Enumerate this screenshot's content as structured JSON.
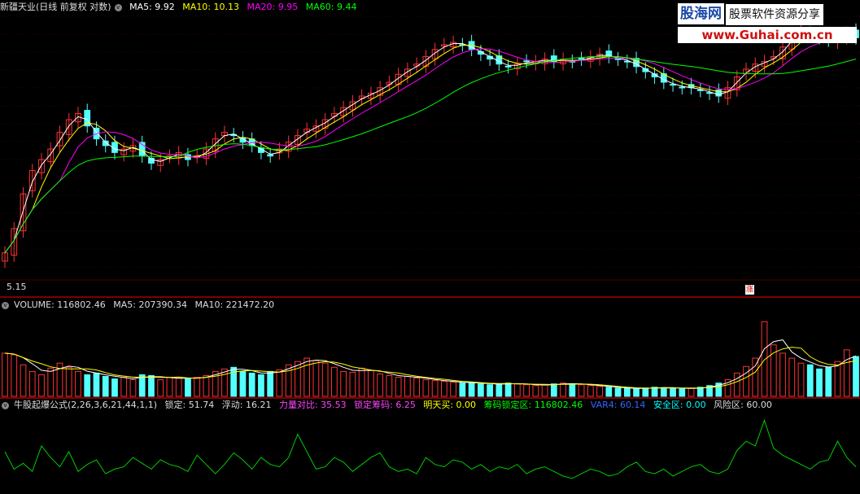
{
  "price_header": {
    "title": "新疆天业(日线 前复权 对数)",
    "indicators": [
      {
        "label": "MA5: 9.92",
        "color": "#ffffff"
      },
      {
        "label": "MA10: 10.13",
        "color": "#ffff00"
      },
      {
        "label": "MA20: 9.95",
        "color": "#ff00ff"
      },
      {
        "label": "MA60: 9.44",
        "color": "#00ff00"
      }
    ]
  },
  "volume_header": {
    "indicators": [
      {
        "label": "VOLUME: 116802.46",
        "color": "#dddddd"
      },
      {
        "label": "MA5: 207390.34",
        "color": "#dddddd"
      },
      {
        "label": "MA10: 221472.20",
        "color": "#dddddd"
      }
    ]
  },
  "formula_header": {
    "indicators": [
      {
        "label": "牛股起爆公式(2,26,3,6,21,44,1,1)",
        "color": "#dddddd"
      },
      {
        "label": "锁定: 51.74",
        "color": "#dddddd"
      },
      {
        "label": "浮动: 16.21",
        "color": "#dddddd"
      },
      {
        "label": "力量对比: 35.53",
        "color": "#ff44ff"
      },
      {
        "label": "锁定筹码: 6.25",
        "color": "#ff44ff"
      },
      {
        "label": "明天买: 0.00",
        "color": "#ffff00"
      },
      {
        "label": "筹码锁定区: 116802.46",
        "color": "#00ff00"
      },
      {
        "label": "VAR4: 60.14",
        "color": "#3366ff"
      },
      {
        "label": "安全区: 0.00",
        "color": "#00ffff"
      },
      {
        "label": "风险区: 60.00",
        "color": "#dddddd"
      }
    ]
  },
  "min_price_label": "5.15",
  "marker_label": "涨",
  "watermark": {
    "logo": "股海网",
    "slogan": "股票软件资源分享",
    "url": "www.Guhai.com.cn"
  },
  "chart_data": [
    {
      "type": "candlestick",
      "panel": "price",
      "scale": "log",
      "ylim": [
        5.0,
        12.4
      ],
      "up_color": "#ff3232",
      "down_color": "#54ffff",
      "min_label": 5.15,
      "closes": [
        5.3,
        5.8,
        6.6,
        7.2,
        7.5,
        7.8,
        8.3,
        8.7,
        8.9,
        8.5,
        8.1,
        7.9,
        7.7,
        7.8,
        7.9,
        7.6,
        7.4,
        7.5,
        7.6,
        7.7,
        7.5,
        7.6,
        7.8,
        8.1,
        8.3,
        8.2,
        8.0,
        7.9,
        7.7,
        7.6,
        7.8,
        8.0,
        8.2,
        8.4,
        8.5,
        8.7,
        8.9,
        9.1,
        9.3,
        9.5,
        9.6,
        9.8,
        10.0,
        10.3,
        10.5,
        10.7,
        11.0,
        11.3,
        11.5,
        11.6,
        11.5,
        11.3,
        11.1,
        10.9,
        10.7,
        10.6,
        10.7,
        10.8,
        10.8,
        10.9,
        10.8,
        10.9,
        10.8,
        10.9,
        11.0,
        11.1,
        11.0,
        10.9,
        10.8,
        10.6,
        10.4,
        10.2,
        10.0,
        9.9,
        9.8,
        9.8,
        9.7,
        9.6,
        9.5,
        9.8,
        10.2,
        10.5,
        10.7,
        10.8,
        11.0,
        11.4,
        11.9,
        12.1,
        12.0,
        11.8,
        11.7,
        11.9,
        12.0,
        11.8
      ]
    },
    {
      "type": "line",
      "panel": "price",
      "series": [
        {
          "name": "MA5",
          "color": "#ffffff"
        },
        {
          "name": "MA10",
          "color": "#ffff00"
        },
        {
          "name": "MA20",
          "color": "#ff00ff"
        },
        {
          "name": "MA60",
          "color": "#00ff00"
        }
      ]
    },
    {
      "type": "bar",
      "panel": "volume",
      "ylim": [
        0,
        1000
      ],
      "values": [
        520,
        500,
        380,
        300,
        260,
        340,
        400,
        350,
        300,
        260,
        280,
        240,
        210,
        230,
        200,
        260,
        250,
        200,
        230,
        220,
        210,
        230,
        250,
        300,
        330,
        350,
        300,
        280,
        260,
        300,
        320,
        380,
        420,
        460,
        430,
        400,
        350,
        300,
        290,
        340,
        310,
        270,
        250,
        230,
        240,
        220,
        200,
        190,
        180,
        170,
        160,
        170,
        150,
        140,
        150,
        160,
        150,
        140,
        130,
        140,
        150,
        160,
        150,
        140,
        130,
        120,
        110,
        100,
        95,
        90,
        100,
        110,
        105,
        100,
        90,
        95,
        110,
        130,
        160,
        200,
        280,
        360,
        460,
        900,
        620,
        520,
        460,
        400,
        380,
        330,
        350,
        420,
        560,
        480
      ],
      "lines": [
        {
          "name": "MA5",
          "color": "#ffffff"
        },
        {
          "name": "MA10",
          "color": "#ffff00"
        }
      ]
    },
    {
      "type": "line",
      "panel": "formula",
      "series": [
        {
          "name": "VAR4",
          "color": "#00cc00",
          "values": [
            35,
            20,
            25,
            18,
            40,
            30,
            22,
            35,
            18,
            24,
            28,
            16,
            20,
            22,
            30,
            25,
            20,
            28,
            24,
            22,
            18,
            32,
            24,
            16,
            24,
            34,
            28,
            20,
            30,
            24,
            22,
            30,
            50,
            35,
            20,
            22,
            30,
            26,
            18,
            24,
            30,
            34,
            22,
            18,
            20,
            16,
            30,
            24,
            22,
            28,
            26,
            20,
            24,
            18,
            22,
            20,
            24,
            16,
            20,
            22,
            18,
            14,
            12,
            16,
            20,
            18,
            14,
            16,
            22,
            26,
            18,
            16,
            20,
            14,
            18,
            22,
            24,
            18,
            16,
            20,
            36,
            44,
            40,
            62,
            38,
            32,
            28,
            24,
            20,
            26,
            28,
            44,
            30,
            22
          ]
        }
      ]
    }
  ]
}
